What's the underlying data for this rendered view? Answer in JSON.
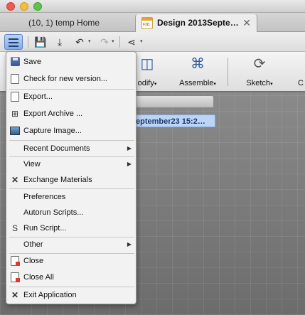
{
  "tabs": {
    "home_label": "(10, 1) temp Home",
    "active_label": "Design 2013Septe…",
    "close_glyph": "✕"
  },
  "qat": {
    "menu_icon": "hamburger-icon",
    "glyphs": {
      "save": "💾",
      "export": "⤓",
      "undo": "↶",
      "redo": "↷",
      "share": "⋖",
      "dropdown": "▾"
    }
  },
  "ribbon": {
    "modify_label": "odify",
    "assemble_label": "Assemble",
    "sketch_label": "Sketch",
    "overflow_label": "C",
    "dropdown_glyph": "▾"
  },
  "browser": {
    "node_label": "eptember23 15:2…"
  },
  "menu": {
    "items": [
      {
        "label": "Save",
        "icon": "save-icon"
      },
      {
        "label": "Check for new version...",
        "icon": "check-version-icon"
      },
      {
        "label": "Export...",
        "icon": "export-icon"
      },
      {
        "label": "Export Archive ...",
        "icon": "export-archive-icon"
      },
      {
        "label": "Capture Image...",
        "icon": "capture-image-icon"
      },
      {
        "label": "Recent Documents",
        "submenu": true
      },
      {
        "label": "View",
        "submenu": true
      },
      {
        "label": "Exchange Materials",
        "icon": "exchange-materials-icon"
      },
      {
        "label": "Preferences"
      },
      {
        "label": "Autorun Scripts..."
      },
      {
        "label": "Run Script...",
        "icon": "run-script-icon"
      },
      {
        "label": "Other",
        "submenu": true
      },
      {
        "label": "Close",
        "icon": "close-doc-icon"
      },
      {
        "label": "Close All",
        "icon": "close-all-icon"
      },
      {
        "label": "Exit Application",
        "icon": "exit-application-icon"
      }
    ],
    "submenu_glyph": "▶",
    "script_glyph": "S",
    "x_glyph": "✕"
  },
  "colors": {
    "accent": "#86aee6",
    "selection": "#bcd4f5",
    "close_red": "#d83b2f"
  }
}
